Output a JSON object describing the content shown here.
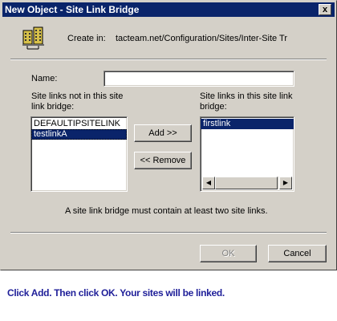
{
  "window": {
    "title": "New Object - Site Link Bridge",
    "close_glyph": "x"
  },
  "header": {
    "icon": "site-link-bridge-icon",
    "create_in_label": "Create in:",
    "create_in_path": "tacteam.net/Configuration/Sites/Inter-Site Tr"
  },
  "form": {
    "name_label": "Name:",
    "name_value": "",
    "left_list_label": "Site links not in this site link bridge:",
    "left_list_items": [
      "DEFAULTIPSITELINK",
      "testlinkA"
    ],
    "left_selected_index": 1,
    "right_list_label": "Site links in this site link bridge:",
    "right_list_items": [
      "firstlink"
    ],
    "right_selected_index": 0,
    "add_button": "Add >>",
    "remove_button": "<< Remove",
    "info": "A site link bridge must contain at least two site links."
  },
  "buttons": {
    "ok": "OK",
    "cancel": "Cancel"
  },
  "instruction": "Click Add. Then click OK. Your sites will be linked.",
  "colors": {
    "titlebar": "#0a246a",
    "selection": "#0a246a",
    "dialog_face": "#d4d0c8",
    "instruction_text": "#1f1f99"
  }
}
